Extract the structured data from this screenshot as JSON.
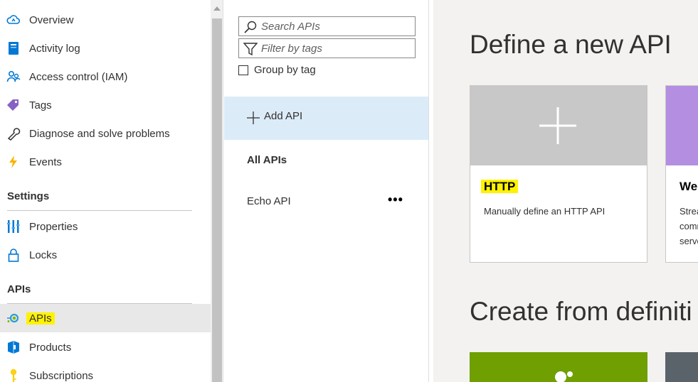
{
  "nav": {
    "items_top": [
      {
        "label": "Overview",
        "icon": "overview-icon"
      },
      {
        "label": "Activity log",
        "icon": "activity-log-icon"
      },
      {
        "label": "Access control (IAM)",
        "icon": "access-control-icon"
      },
      {
        "label": "Tags",
        "icon": "tag-icon"
      },
      {
        "label": "Diagnose and solve problems",
        "icon": "wrench-icon"
      },
      {
        "label": "Events",
        "icon": "lightning-icon"
      }
    ],
    "settings_header": "Settings",
    "settings_items": [
      {
        "label": "Properties",
        "icon": "properties-icon"
      },
      {
        "label": "Locks",
        "icon": "lock-icon"
      }
    ],
    "apis_header": "APIs",
    "apis_items": [
      {
        "label": "APIs",
        "icon": "api-icon",
        "selected": true
      },
      {
        "label": "Products",
        "icon": "products-icon"
      },
      {
        "label": "Subscriptions",
        "icon": "key-icon"
      }
    ]
  },
  "list": {
    "search_placeholder": "Search APIs",
    "filter_placeholder": "Filter by tags",
    "group_by_tag": "Group by tag",
    "add_api": "Add API",
    "all_apis": "All APIs",
    "apis": [
      {
        "label": "Echo API",
        "more": "..."
      }
    ]
  },
  "main": {
    "define_heading": "Define a new API",
    "create_heading": "Create from definiti",
    "tiles": [
      {
        "title": "HTTP",
        "desc": "Manually define an HTTP API"
      },
      {
        "title": "We",
        "desc_lines": [
          "Strea",
          "comm",
          "serve"
        ]
      }
    ]
  },
  "colors": {
    "highlight": "#fff200",
    "selected_bg": "#e8e8e8",
    "add_api_bg": "#dcebf8",
    "http_tile_top": "#c8c8c8",
    "ws_tile_top": "#b48ee0",
    "openapi_tile": "#6f9f00",
    "dark_tile": "#5b636a"
  }
}
